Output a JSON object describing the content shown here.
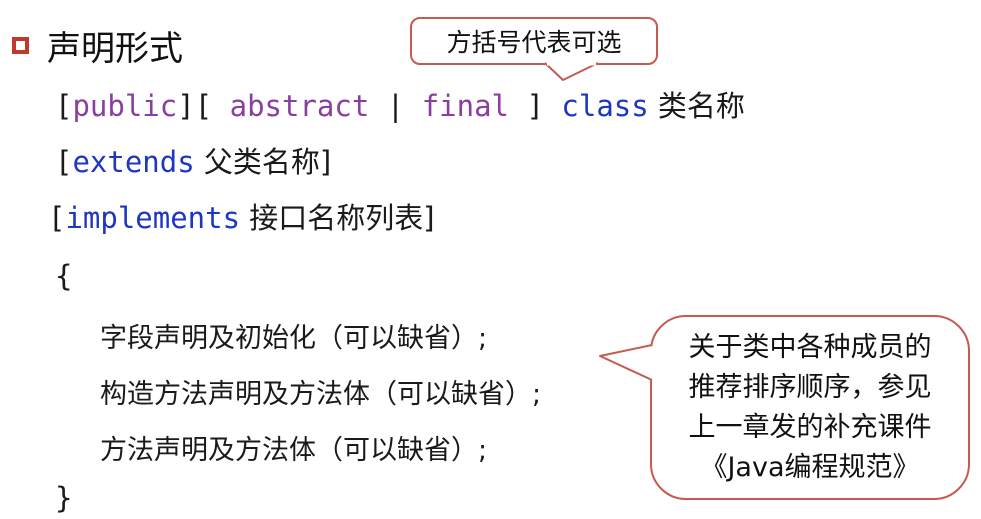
{
  "heading": "声明形式",
  "top_callout": "方括号代表可选",
  "code": {
    "line1": {
      "open1": "[",
      "public": "public",
      "close1_open2": "][ ",
      "abstract": "abstract",
      "pipe": " | ",
      "final": "final",
      "close2": " ] ",
      "class": "class",
      "name": " 类名称"
    },
    "line2": {
      "open": "[",
      "extends": "extends",
      "rest": " 父类名称]"
    },
    "line3": {
      "open": "[",
      "implements": "implements",
      "rest": " 接口名称列表]"
    },
    "brace_open": "{",
    "brace_close": "}"
  },
  "body_lines": [
    "字段声明及初始化（可以缺省）;",
    "构造方法声明及方法体（可以缺省）;",
    "方法声明及方法体（可以缺省）;"
  ],
  "side_callout": [
    "关于类中各种成员的",
    "推荐排序顺序，参见",
    "上一章发的补充课件",
    "《Java编程规范》"
  ],
  "colors": {
    "accent_red": "#c0392b",
    "keyword_purple": "#8a3fa0",
    "keyword_blue": "#1f35c4",
    "callout_border": "#c55a4f"
  }
}
